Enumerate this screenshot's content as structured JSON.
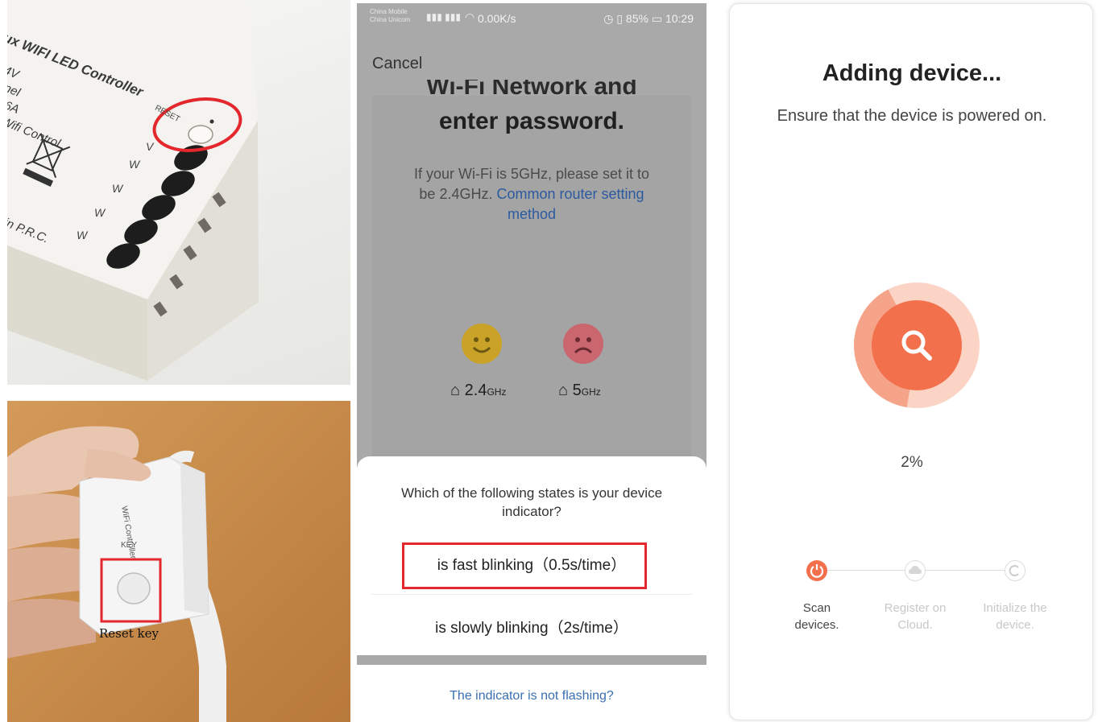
{
  "photo_top": {
    "device_text_lines": [
      "ux WIFI LED Controller",
      "4V",
      "nnel",
      ": 16A",
      "rol/Wifi Control",
      "in P.R.C."
    ],
    "reset_label": "RESET",
    "channel_labels": [
      "V",
      "W",
      "W",
      "W",
      "W"
    ],
    "highlight_color": "#e3272d"
  },
  "photo_bottom": {
    "reset_key_label": "Reset key",
    "module_text": "WiFi Controller",
    "key_label": "KEY",
    "highlight_color": "#e3272d"
  },
  "phone": {
    "status_bar": {
      "carrier_1": "China Mobile",
      "carrier_2": "China Unicom",
      "net_speed": "0.00K/s",
      "battery": "85%",
      "time": "10:29"
    },
    "cancel_label": "Cancel",
    "title_cut": "Wi-Fi Network and",
    "title": "enter password.",
    "hint_text": "If your Wi-Fi is 5GHz, please set it to be 2.4GHz.",
    "hint_link": "Common router setting method",
    "bands": [
      {
        "label": "2.4",
        "unit": "GHz",
        "face": "happy",
        "color": "#c9a227"
      },
      {
        "label": "5",
        "unit": "GHz",
        "face": "sad",
        "color": "#c9666e"
      }
    ],
    "sheet": {
      "question": "Which of the following states is your device indicator?",
      "option_fast": "is fast blinking（0.5s/time）",
      "option_slow": "is slowly blinking（2s/time）",
      "not_flashing": "The indicator is not flashing?"
    }
  },
  "adding": {
    "title": "Adding device...",
    "subtitle": "Ensure that the device is powered on.",
    "progress_percent": "2%",
    "progress_value": 0.02,
    "accent_color": "#f2714c",
    "steps": [
      {
        "label": "Scan devices.",
        "active": true
      },
      {
        "label": "Register on Cloud.",
        "active": false
      },
      {
        "label": "Initialize the device.",
        "active": false
      }
    ]
  }
}
